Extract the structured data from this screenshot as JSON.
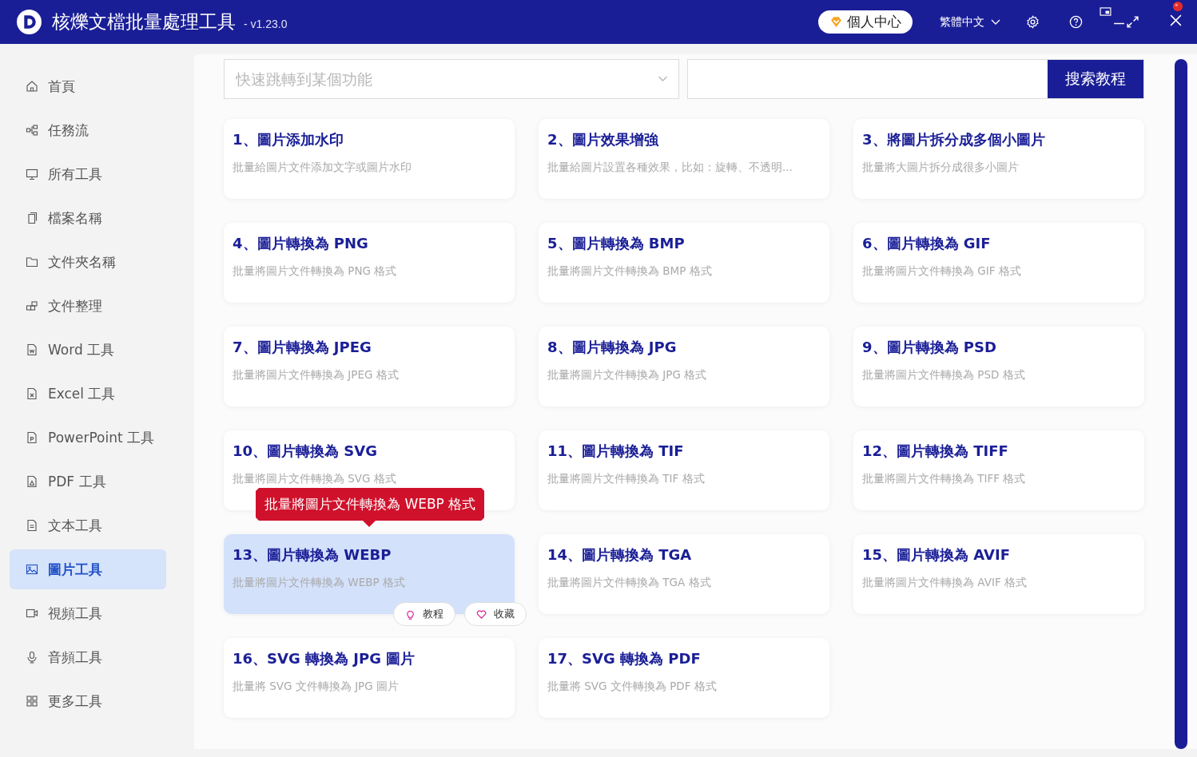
{
  "window": {
    "title": "核爍文檔批量處理工具",
    "version": "- v1.23.0",
    "account_button": "個人中心",
    "language": "繁體中文"
  },
  "sidebar": {
    "items": [
      {
        "label": "首頁",
        "selected": false
      },
      {
        "label": "任務流",
        "selected": false
      },
      {
        "label": "所有工具",
        "selected": false
      },
      {
        "label": "檔案名稱",
        "selected": false
      },
      {
        "label": "文件夾名稱",
        "selected": false
      },
      {
        "label": "文件整理",
        "selected": false
      },
      {
        "label": "Word 工具",
        "selected": false
      },
      {
        "label": "Excel 工具",
        "selected": false
      },
      {
        "label": "PowerPoint 工具",
        "selected": false
      },
      {
        "label": "PDF 工具",
        "selected": false
      },
      {
        "label": "文本工具",
        "selected": false
      },
      {
        "label": "圖片工具",
        "selected": true
      },
      {
        "label": "視頻工具",
        "selected": false
      },
      {
        "label": "音頻工具",
        "selected": false
      },
      {
        "label": "更多工具",
        "selected": false
      }
    ]
  },
  "search": {
    "jump_placeholder": "快速跳轉到某個功能",
    "search_button": "搜索教程"
  },
  "cards": [
    {
      "title": "1、圖片添加水印",
      "description": "批量給圖片文件添加文字或圖片水印",
      "selected": false
    },
    {
      "title": "2、圖片效果增強",
      "description": "批量給圖片設置各種效果，比如：旋轉、不透明...",
      "selected": false
    },
    {
      "title": "3、將圖片拆分成多個小圖片",
      "description": "批量將大圖片拆分成很多小圖片",
      "selected": false
    },
    {
      "title": "4、圖片轉換為 PNG",
      "description": "批量將圖片文件轉換為 PNG 格式",
      "selected": false
    },
    {
      "title": "5、圖片轉換為 BMP",
      "description": "批量將圖片文件轉換為 BMP 格式",
      "selected": false
    },
    {
      "title": "6、圖片轉換為 GIF",
      "description": "批量將圖片文件轉換為 GIF 格式",
      "selected": false
    },
    {
      "title": "7、圖片轉換為 JPEG",
      "description": "批量將圖片文件轉換為 JPEG 格式",
      "selected": false
    },
    {
      "title": "8、圖片轉換為 JPG",
      "description": "批量將圖片文件轉換為 JPG 格式",
      "selected": false
    },
    {
      "title": "9、圖片轉換為 PSD",
      "description": "批量將圖片文件轉換為 PSD 格式",
      "selected": false
    },
    {
      "title": "10、圖片轉換為 SVG",
      "description": "批量將圖片文件轉換為 SVG 格式",
      "selected": false
    },
    {
      "title": "11、圖片轉換為 TIF",
      "description": "批量將圖片文件轉換為 TIF 格式",
      "selected": false
    },
    {
      "title": "12、圖片轉換為 TIFF",
      "description": "批量將圖片文件轉換為 TIFF 格式",
      "selected": false
    },
    {
      "title": "13、圖片轉換為 WEBP",
      "description": "批量將圖片文件轉換為 WEBP 格式",
      "selected": true,
      "tooltip": "批量將圖片文件轉換為 WEBP 格式",
      "actions": [
        "教程",
        "收藏"
      ]
    },
    {
      "title": "14、圖片轉換為 TGA",
      "description": "批量將圖片文件轉換為 TGA 格式",
      "selected": false
    },
    {
      "title": "15、圖片轉換為 AVIF",
      "description": "批量將圖片文件轉換為 AVIF 格式",
      "selected": false
    },
    {
      "title": "16、SVG 轉換為 JPG 圖片",
      "description": "批量將 SVG 文件轉換為 JPG 圖片",
      "selected": false
    },
    {
      "title": "17、SVG 轉換為 PDF",
      "description": "批量將 SVG 文件轉換為 PDF 格式",
      "selected": false
    }
  ]
}
